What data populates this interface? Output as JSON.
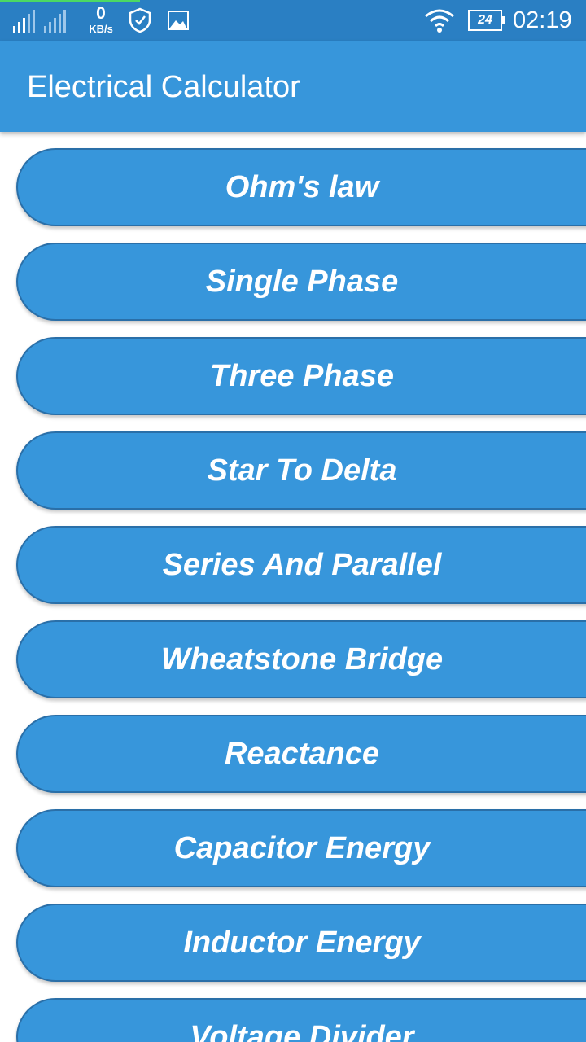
{
  "status_bar": {
    "net_speed_value": "0",
    "net_speed_unit": "KB/s",
    "battery_level": "24",
    "time": "02:19",
    "icons": [
      "signal-icon",
      "shield-icon",
      "image-icon",
      "wifi-icon",
      "battery-icon"
    ]
  },
  "app_bar": {
    "title": "Electrical Calculator"
  },
  "menu": {
    "items": [
      "Ohm's law",
      "Single Phase",
      "Three Phase",
      "Star To Delta",
      "Series And Parallel",
      "Wheatstone Bridge",
      "Reactance",
      "Capacitor Energy",
      "Inductor Energy",
      "Voltage Divider"
    ]
  },
  "colors": {
    "status_bar": "#2a7fc3",
    "primary": "#3796db",
    "button_border": "#2a6fa8",
    "text": "#ffffff"
  }
}
